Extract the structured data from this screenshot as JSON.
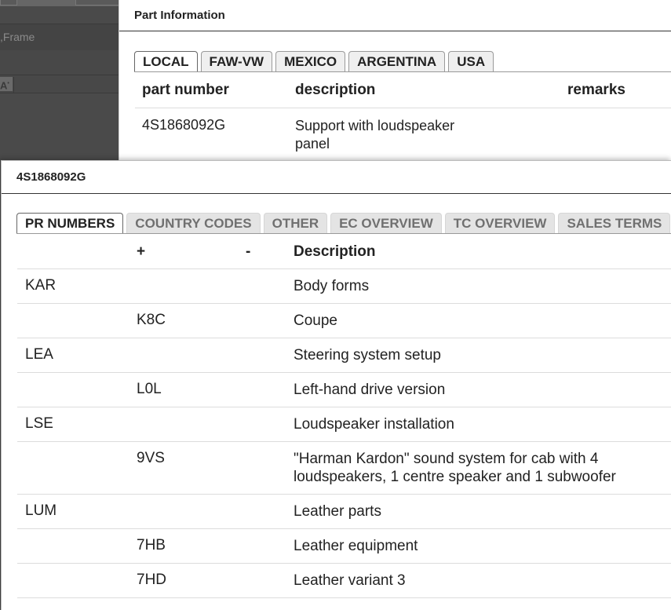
{
  "background": {
    "row1_text": ",Frame",
    "cell_text": "A"
  },
  "part_info": {
    "title": "Part Information",
    "tabs": [
      "LOCAL",
      "FAW-VW",
      "MEXICO",
      "ARGENTINA",
      "USA"
    ],
    "columns": [
      "part number",
      "description",
      "remarks"
    ],
    "rows": [
      {
        "part_number": "4S1868092G",
        "description": "Support with loudspeaker panel",
        "remarks": ""
      }
    ]
  },
  "pr_dialog": {
    "title": "4S1868092G",
    "tabs": [
      "PR NUMBERS",
      "COUNTRY CODES",
      "OTHER",
      "EC OVERVIEW",
      "TC OVERVIEW",
      "SALES TERMS"
    ],
    "columns": {
      "family": "",
      "plus": "+",
      "minus": "-",
      "description": "Description"
    },
    "rows": [
      {
        "family": "KAR",
        "plus": "",
        "minus": "",
        "description": "Body forms"
      },
      {
        "family": "",
        "plus": "K8C",
        "minus": "",
        "description": "Coupe"
      },
      {
        "family": "LEA",
        "plus": "",
        "minus": "",
        "description": "Steering system setup"
      },
      {
        "family": "",
        "plus": "L0L",
        "minus": "",
        "description": "Left-hand drive version"
      },
      {
        "family": "LSE",
        "plus": "",
        "minus": "",
        "description": "Loudspeaker installation"
      },
      {
        "family": "",
        "plus": "9VS",
        "minus": "",
        "description": "\"Harman Kardon\" sound system for cab with 4 loudspeakers, 1 centre speaker and 1 subwoofer"
      },
      {
        "family": "LUM",
        "plus": "",
        "minus": "",
        "description": "Leather parts"
      },
      {
        "family": "",
        "plus": "7HB",
        "minus": "",
        "description": "Leather equipment"
      },
      {
        "family": "",
        "plus": "7HD",
        "minus": "",
        "description": "Leather variant 3"
      }
    ]
  }
}
